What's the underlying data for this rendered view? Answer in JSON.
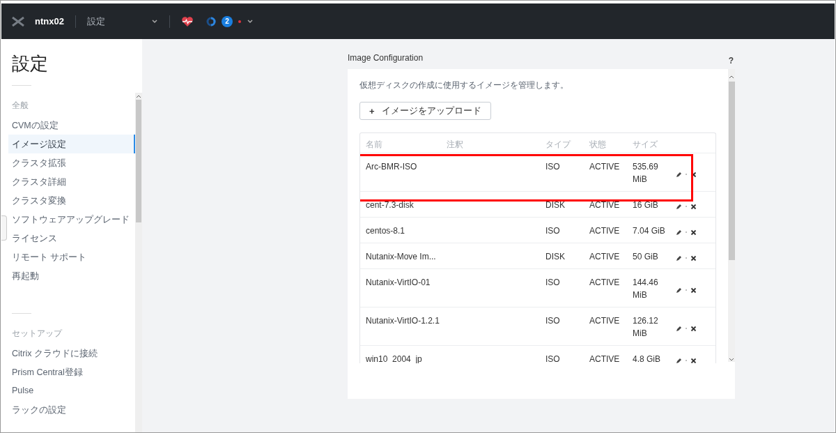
{
  "topbar": {
    "cluster_name": "ntnx02",
    "section": "設定",
    "alert_count": "2"
  },
  "sidebar": {
    "title": "設定",
    "groups": [
      {
        "heading": "全般",
        "items": [
          {
            "label": "CVMの設定",
            "selected": false
          },
          {
            "label": "イメージ設定",
            "selected": true
          },
          {
            "label": "クラスタ拡張",
            "selected": false
          },
          {
            "label": "クラスタ詳細",
            "selected": false
          },
          {
            "label": "クラスタ変換",
            "selected": false
          },
          {
            "label": "ソフトウェアアップグレード",
            "selected": false
          },
          {
            "label": "ライセンス",
            "selected": false
          },
          {
            "label": "リモート サポート",
            "selected": false
          },
          {
            "label": "再起動",
            "selected": false
          }
        ]
      },
      {
        "heading": "セットアップ",
        "items": [
          {
            "label": "Citrix クラウドに接続",
            "selected": false
          },
          {
            "label": "Prism Central登録",
            "selected": false
          },
          {
            "label": "Pulse",
            "selected": false
          },
          {
            "label": "ラックの設定",
            "selected": false
          }
        ]
      }
    ]
  },
  "panel": {
    "title": "Image Configuration",
    "help": "?",
    "description": "仮想ディスクの作成に使用するイメージを管理します。",
    "upload_button": {
      "icon": "+",
      "label": "イメージをアップロード"
    },
    "table": {
      "columns": [
        "名前",
        "注釈",
        "タイプ",
        "状態",
        "サイズ"
      ],
      "rows": [
        {
          "name": "Arc-BMR-ISO",
          "type": "ISO",
          "state": "ACTIVE",
          "size": "535.69 MiB",
          "highlighted": true
        },
        {
          "name": "cent-7.3-disk",
          "type": "DISK",
          "state": "ACTIVE",
          "size": "16 GiB",
          "highlighted": false
        },
        {
          "name": "centos-8.1",
          "type": "ISO",
          "state": "ACTIVE",
          "size": "7.04 GiB",
          "highlighted": false
        },
        {
          "name": "Nutanix-Move Im...",
          "type": "DISK",
          "state": "ACTIVE",
          "size": "50 GiB",
          "highlighted": false
        },
        {
          "name": "Nutanix-VirtIO-01",
          "type": "ISO",
          "state": "ACTIVE",
          "size": "144.46 MiB",
          "highlighted": false
        },
        {
          "name": "Nutanix-VirtIO-1.2.1",
          "type": "ISO",
          "state": "ACTIVE",
          "size": "126.12 MiB",
          "highlighted": false
        },
        {
          "name": "win10_2004_jp",
          "type": "ISO",
          "state": "ACTIVE",
          "size": "4.8 GiB",
          "highlighted": false
        }
      ]
    }
  }
}
